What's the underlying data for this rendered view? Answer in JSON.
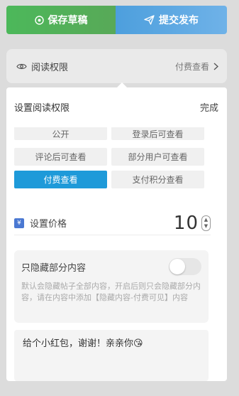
{
  "toolbar": {
    "save_label": "保存草稿",
    "publish_label": "提交发布"
  },
  "read_permission": {
    "label": "阅读权限",
    "value": "付费查看"
  },
  "panel": {
    "title": "设置阅读权限",
    "done_label": "完成",
    "options": [
      {
        "label": "公开",
        "active": false
      },
      {
        "label": "登录后可查看",
        "active": false
      },
      {
        "label": "评论后可查看",
        "active": false
      },
      {
        "label": "部分用户可查看",
        "active": false
      },
      {
        "label": "付费查看",
        "active": true
      },
      {
        "label": "支付积分查看",
        "active": false
      }
    ],
    "price": {
      "icon_text": "¥",
      "label": "设置价格",
      "value": "10"
    },
    "hide_partial": {
      "title": "只隐藏部分内容",
      "enabled": false,
      "description": "默认会隐藏帖子全部内容，开启后则只会隐藏部分内容，请在内容中添加【隐藏内容-付费可见】内容"
    },
    "message": "给个小红包，谢谢！亲亲你😘"
  },
  "colors": {
    "save_green": "#4cb85a",
    "publish_blue": "#5aa8e2",
    "active_option": "#1e9ad9"
  }
}
